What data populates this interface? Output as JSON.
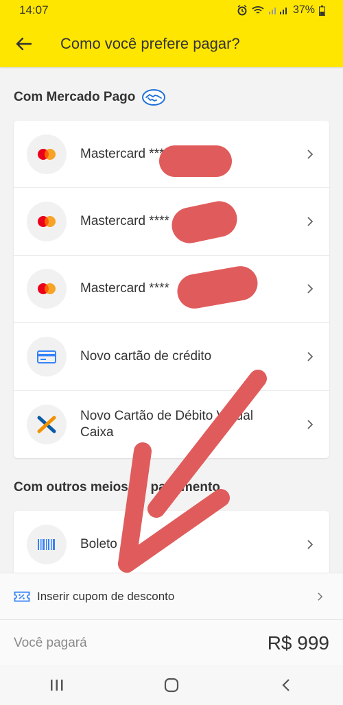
{
  "status_bar": {
    "time": "14:07",
    "battery": "37%"
  },
  "app_bar": {
    "title": "Como você prefere pagar?"
  },
  "section_mp": {
    "title": "Com Mercado Pago"
  },
  "mp_methods": [
    {
      "label": "Mastercard ****",
      "icon": "mastercard-icon"
    },
    {
      "label": "Mastercard ****",
      "icon": "mastercard-icon"
    },
    {
      "label": "Mastercard ****",
      "icon": "mastercard-icon"
    },
    {
      "label": "Novo cartão de crédito",
      "icon": "credit-card-icon"
    },
    {
      "label": "Novo Cartão de Débito Virtual Caixa",
      "icon": "caixa-icon"
    }
  ],
  "section_other": {
    "title": "Com outros meios de pagamento"
  },
  "other_methods": [
    {
      "label": "Boleto",
      "icon": "barcode-icon"
    }
  ],
  "coupon": {
    "label": "Inserir cupom de desconto"
  },
  "payment": {
    "label": "Você pagará",
    "amount": "R$ 999"
  },
  "colors": {
    "brand_yellow": "#ffe600",
    "redaction": "#e05c5c",
    "accent_blue": "#3483fa"
  }
}
